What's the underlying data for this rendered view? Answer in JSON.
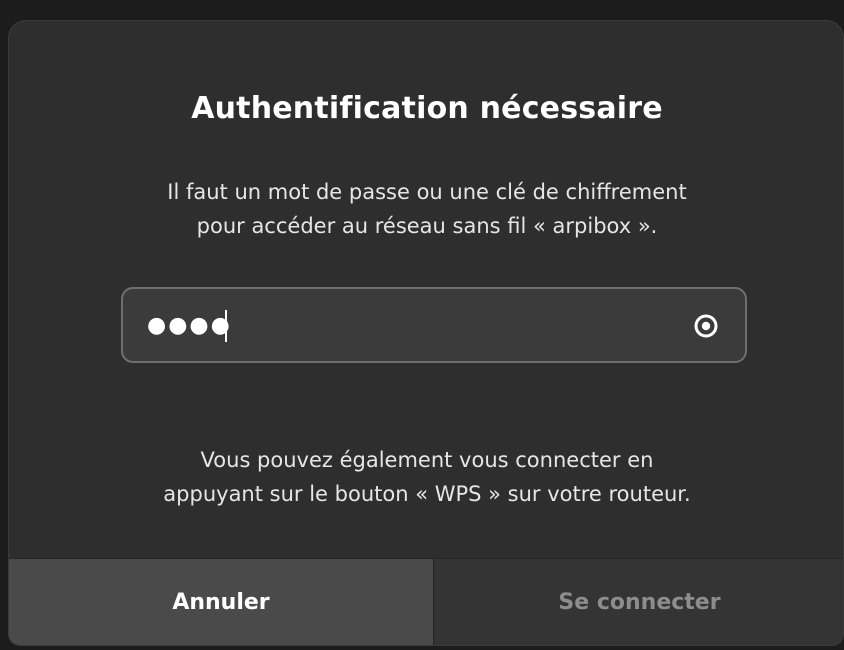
{
  "dialog": {
    "title": "Authentification nécessaire",
    "message_lines": [
      "Il faut un mot de passe ou une clé de chiffrement",
      "pour accéder au réseau sans fil « arpibox »."
    ],
    "password": {
      "value": "●●●●",
      "icon": "eye-icon"
    },
    "wps_lines": [
      "Vous pouvez également vous connecter en",
      "appuyant sur le bouton « WPS » sur votre routeur."
    ],
    "buttons": {
      "cancel_label": "Annuler",
      "connect_label": "Se connecter"
    }
  },
  "colors": {
    "background": "#2e2e2e",
    "field": "#3b3b3b",
    "cancel_button": "#4a4a4a",
    "connect_button_disabled_text": "#8d8d8d"
  }
}
